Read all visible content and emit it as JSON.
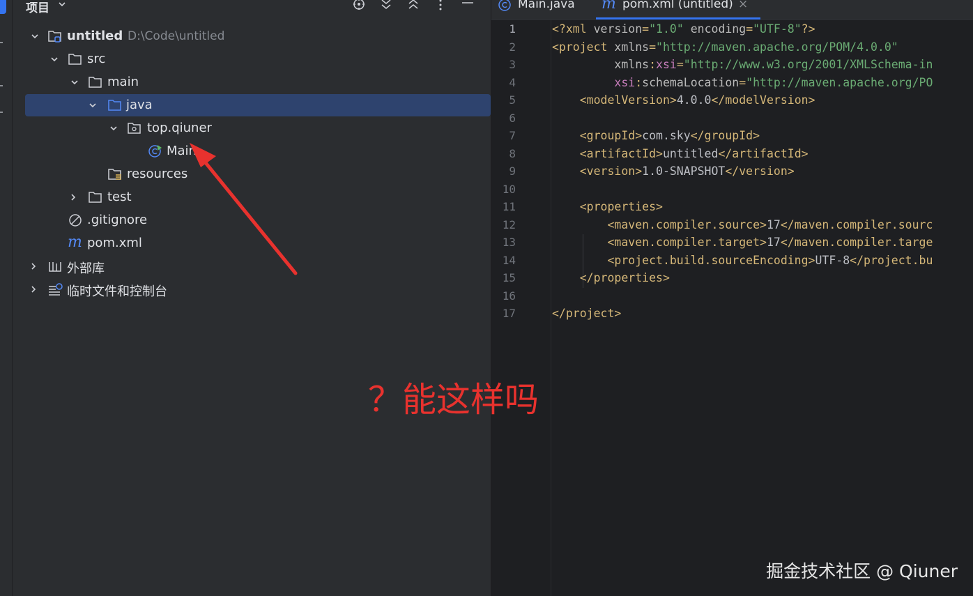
{
  "project_panel": {
    "title": "项目",
    "tree": [
      {
        "label": "untitled",
        "path": "D:\\Code\\untitled",
        "icon": "module-folder-icon"
      },
      {
        "label": "src",
        "icon": "folder-icon"
      },
      {
        "label": "main",
        "icon": "folder-icon"
      },
      {
        "label": "java",
        "icon": "source-folder-icon"
      },
      {
        "label": "top.qiuner",
        "icon": "package-icon"
      },
      {
        "label": "Main",
        "icon": "java-class-icon"
      },
      {
        "label": "resources",
        "icon": "resources-folder-icon"
      },
      {
        "label": "test",
        "icon": "folder-icon"
      },
      {
        "label": ".gitignore",
        "icon": "ignored-file-icon"
      },
      {
        "label": "pom.xml",
        "icon": "maven-icon"
      },
      {
        "label": "外部库",
        "icon": "library-icon"
      },
      {
        "label": "临时文件和控制台",
        "icon": "scratches-icon"
      }
    ]
  },
  "editor": {
    "tabs": [
      {
        "label": "Main.java",
        "icon": "java-class-icon",
        "active": false
      },
      {
        "label": "pom.xml (untitled)",
        "icon": "maven-icon",
        "active": true,
        "close": "×"
      }
    ],
    "line_numbers": [
      "1",
      "2",
      "3",
      "4",
      "5",
      "6",
      "7",
      "8",
      "9",
      "10",
      "11",
      "12",
      "13",
      "14",
      "15",
      "16",
      "17"
    ],
    "lines": [
      [
        [
          "t",
          "<?xml "
        ],
        [
          "a",
          "version"
        ],
        [
          "t",
          "="
        ],
        [
          "s",
          "\"1.0\""
        ],
        [
          "t",
          " "
        ],
        [
          "a",
          "encoding"
        ],
        [
          "t",
          "="
        ],
        [
          "s",
          "\"UTF-8\""
        ],
        [
          "t",
          "?>"
        ]
      ],
      [
        [
          "t",
          "<project "
        ],
        [
          "a",
          "xmlns"
        ],
        [
          "t",
          "="
        ],
        [
          "s",
          "\"http://maven.apache.org/POM/4.0.0\""
        ]
      ],
      [
        [
          "a",
          "         xmlns"
        ],
        [
          "t",
          ":"
        ],
        [
          "n",
          "xsi"
        ],
        [
          "t",
          "="
        ],
        [
          "s",
          "\"http://www.w3.org/2001/XMLSchema-in"
        ]
      ],
      [
        [
          "n",
          "         xsi"
        ],
        [
          "t",
          ":"
        ],
        [
          "a",
          "schemaLocation"
        ],
        [
          "t",
          "="
        ],
        [
          "s",
          "\"http://maven.apache.org/PO"
        ]
      ],
      [
        [
          "t",
          "    <modelVersion>"
        ],
        [
          "p",
          "4.0.0"
        ],
        [
          "t",
          "</modelVersion>"
        ]
      ],
      [],
      [
        [
          "t",
          "    <groupId>"
        ],
        [
          "p",
          "com.sky"
        ],
        [
          "t",
          "</groupId>"
        ]
      ],
      [
        [
          "t",
          "    <artifactId>"
        ],
        [
          "p",
          "untitled"
        ],
        [
          "t",
          "</artifactId>"
        ]
      ],
      [
        [
          "t",
          "    <version>"
        ],
        [
          "p",
          "1.0-SNAPSHOT"
        ],
        [
          "t",
          "</version>"
        ]
      ],
      [],
      [
        [
          "t",
          "    <properties>"
        ]
      ],
      [
        [
          "t",
          "        <maven.compiler.source>"
        ],
        [
          "p",
          "17"
        ],
        [
          "t",
          "</maven.compiler.sourc"
        ]
      ],
      [
        [
          "t",
          "        <maven.compiler.target>"
        ],
        [
          "p",
          "17"
        ],
        [
          "t",
          "</maven.compiler.targe"
        ]
      ],
      [
        [
          "t",
          "        <project.build.sourceEncoding>"
        ],
        [
          "p",
          "UTF-8"
        ],
        [
          "t",
          "</project.bu"
        ]
      ],
      [
        [
          "t",
          "    </properties>"
        ]
      ],
      [],
      [
        [
          "t",
          "</project>"
        ]
      ]
    ]
  },
  "annotation": {
    "text": "？能这样吗",
    "color": "#e8322e"
  },
  "watermark": "掘金技术社区 @ Qiuner",
  "colors": {
    "tag": "#d5b778",
    "attr": "#bababa",
    "string": "#6aab73",
    "ns": "#c77dbb",
    "plain": "#bcbec4",
    "selection": "#2e436e",
    "accent": "#3574f0"
  }
}
